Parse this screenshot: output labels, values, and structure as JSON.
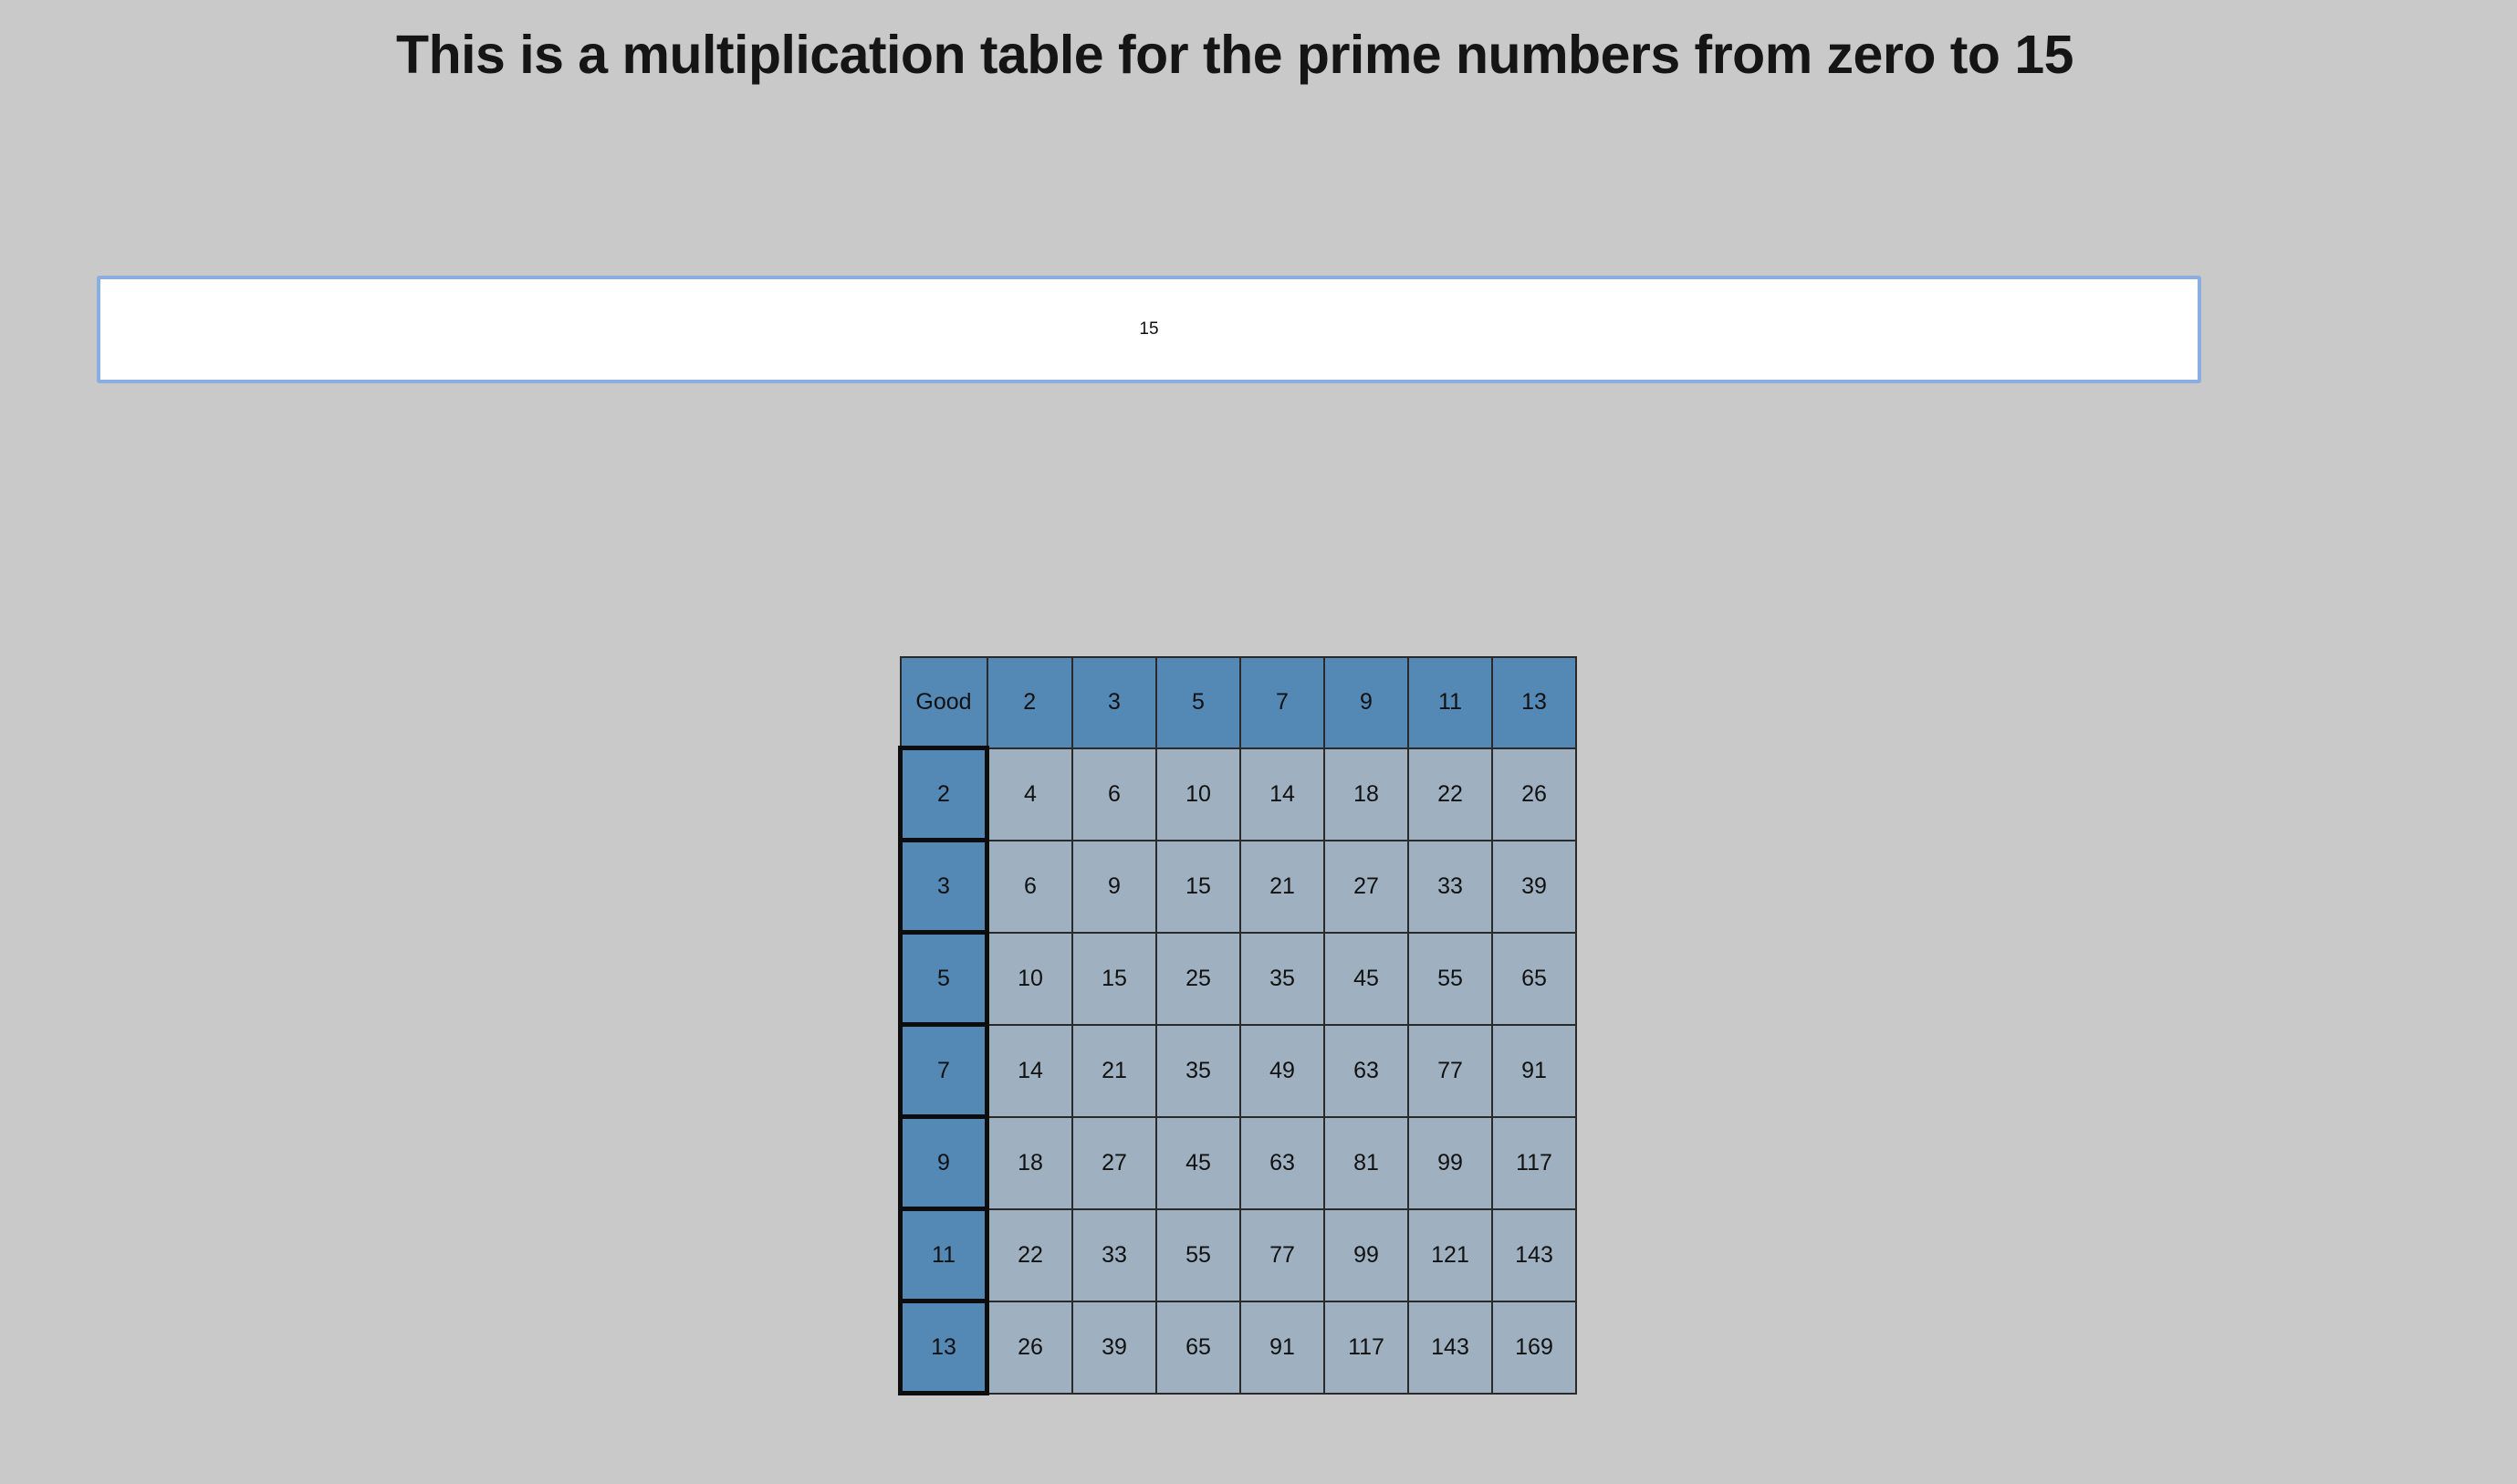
{
  "page": {
    "title": "This is a multiplication table for the prime numbers from zero to 15"
  },
  "input": {
    "value": "15"
  },
  "table": {
    "corner_label": "Good",
    "primes": [
      "2",
      "3",
      "5",
      "7",
      "9",
      "11",
      "13"
    ],
    "rows": [
      {
        "header": "2",
        "cells": [
          "4",
          "6",
          "10",
          "14",
          "18",
          "22",
          "26"
        ]
      },
      {
        "header": "3",
        "cells": [
          "6",
          "9",
          "15",
          "21",
          "27",
          "33",
          "39"
        ]
      },
      {
        "header": "5",
        "cells": [
          "10",
          "15",
          "25",
          "35",
          "45",
          "55",
          "65"
        ]
      },
      {
        "header": "7",
        "cells": [
          "14",
          "21",
          "35",
          "49",
          "63",
          "77",
          "91"
        ]
      },
      {
        "header": "9",
        "cells": [
          "18",
          "27",
          "45",
          "63",
          "81",
          "99",
          "117"
        ]
      },
      {
        "header": "11",
        "cells": [
          "22",
          "33",
          "55",
          "77",
          "99",
          "121",
          "143"
        ]
      },
      {
        "header": "13",
        "cells": [
          "26",
          "39",
          "65",
          "91",
          "117",
          "143",
          "169"
        ]
      }
    ]
  },
  "colors": {
    "background": "#c9c9c9",
    "header_blue": "#5488b5",
    "cell_gray_blue": "#9fb1c0",
    "input_focus_border": "#8aaee0"
  }
}
